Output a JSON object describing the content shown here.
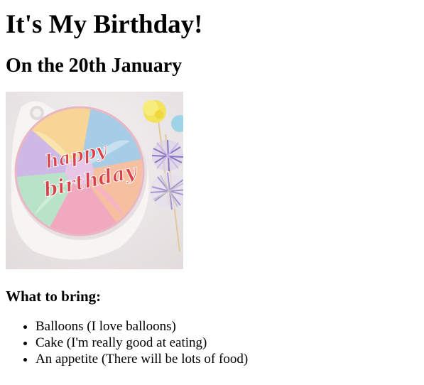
{
  "page": {
    "title": "It's My Birthday!",
    "subtitle": "On the 20th January",
    "bring_heading": "What to bring:",
    "bring_items": [
      "Balloons (I love balloons)",
      "Cake (I'm really good at eating)",
      "An appetite (There will be lots of food)"
    ]
  },
  "image": {
    "cake_text_line1": "happy",
    "cake_text_line2": "birthday",
    "colors": {
      "background": "#ece8e8",
      "plate": "#f6f4f2",
      "frosting_pink": "#f1a9bf",
      "frosting_yellow": "#f6d596",
      "frosting_mint": "#b9e3c8",
      "frosting_blue": "#a7cde6",
      "frosting_lilac": "#cdb8e6",
      "lettering": "#d9414b",
      "pompom_yellow": "#f4e25a",
      "tinsel": "#b6a5d6"
    }
  }
}
